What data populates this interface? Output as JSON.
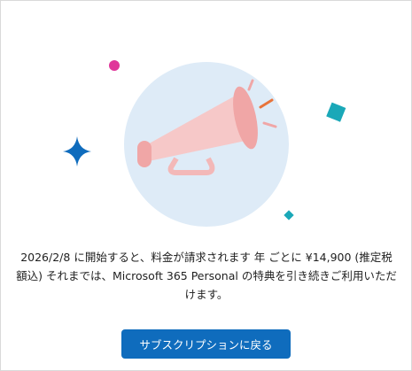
{
  "message": {
    "text": "2026/2/8 に開始すると、料金が請求されます 年 ごとに ¥14,900 (推定税額込) それまでは、Microsoft 365 Personal の特典を引き続きご利用いただけます。"
  },
  "actions": {
    "back_to_subscriptions": "サブスクリプションに戻る"
  },
  "illustration": {
    "icon": "megaphone",
    "colors": {
      "circle": "#deebf7",
      "megaphone_body": "#f6c8c8",
      "megaphone_accent": "#f0a6a6",
      "sparkle": "#0f6cbd",
      "dot": "#e0369a",
      "square": "#1aa8b8"
    }
  },
  "theme": {
    "primary": "#0f6cbd"
  }
}
